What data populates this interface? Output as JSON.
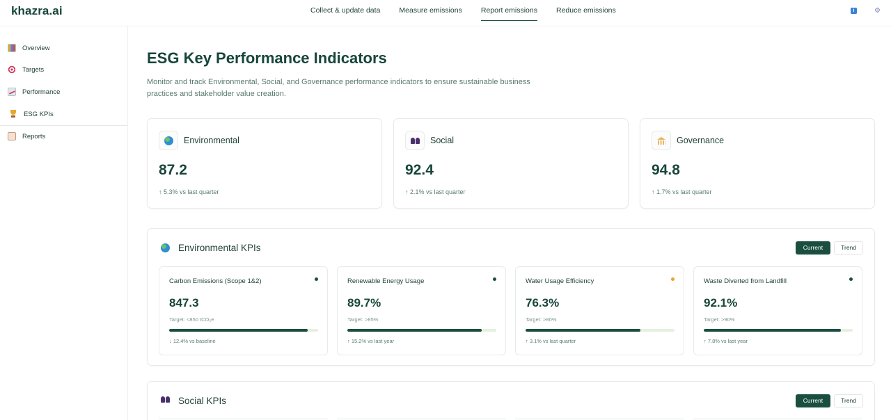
{
  "app": {
    "logo": "khazra.ai"
  },
  "topnav": {
    "items": [
      {
        "label": "Collect & update data"
      },
      {
        "label": "Measure emissions"
      },
      {
        "label": "Report emissions",
        "active": true
      },
      {
        "label": "Reduce emissions"
      }
    ],
    "info_icon": "info-icon",
    "settings_icon": "gear-icon"
  },
  "sidebar": {
    "items": [
      {
        "label": "Overview",
        "icon": "chart-icon"
      },
      {
        "label": "Targets",
        "icon": "target-icon"
      },
      {
        "label": "Performance",
        "icon": "line-chart-icon"
      },
      {
        "label": "ESG KPIs",
        "icon": "trophy-icon",
        "active": true
      },
      {
        "label": "Reports",
        "icon": "clipboard-icon"
      }
    ]
  },
  "page": {
    "title": "ESG Key Performance Indicators",
    "description": "Monitor and track Environmental, Social, and Governance performance indicators to ensure sustainable business practices and stakeholder value creation."
  },
  "summary_cards": [
    {
      "title": "Environmental",
      "value": "87.2",
      "change": "↑ 5.3% vs last quarter",
      "icon": "globe-icon"
    },
    {
      "title": "Social",
      "value": "92.4",
      "change": "↑ 2.1% vs last quarter",
      "icon": "people-icon"
    },
    {
      "title": "Governance",
      "value": "94.8",
      "change": "↑ 1.7% vs last quarter",
      "icon": "temple-icon"
    }
  ],
  "environmental_section": {
    "title": "Environmental KPIs",
    "toggle": {
      "current": "Current",
      "trend": "Trend"
    },
    "kpis": [
      {
        "title": "Carbon Emissions (Scope 1&2)",
        "value": "847.3",
        "target": "Target: <850 tCO₂e",
        "progress": 0.93,
        "change": "↓ 12.4% vs baseline",
        "status": "on-track"
      },
      {
        "title": "Renewable Energy Usage",
        "value": "89.7%",
        "target": "Target: >85%",
        "progress": 0.9,
        "change": "↑ 15.2% vs last year",
        "status": "on-track"
      },
      {
        "title": "Water Usage Efficiency",
        "value": "76.3%",
        "target": "Target: >80%",
        "progress": 0.77,
        "change": "↑ 3.1% vs last quarter",
        "status": "warning",
        "status_color": "#f0a12a"
      },
      {
        "title": "Waste Diverted from Landfill",
        "value": "92.1%",
        "target": "Target: >90%",
        "progress": 0.92,
        "change": "↑ 7.8% vs last year",
        "status": "on-track"
      }
    ]
  },
  "social_section": {
    "title": "Social KPIs",
    "toggle": {
      "current": "Current",
      "trend": "Trend"
    }
  },
  "colors": {
    "brand": "#17463a",
    "accent": "#1a4f40",
    "warning": "#f0a12a",
    "bar_track": "#e5f0df"
  }
}
